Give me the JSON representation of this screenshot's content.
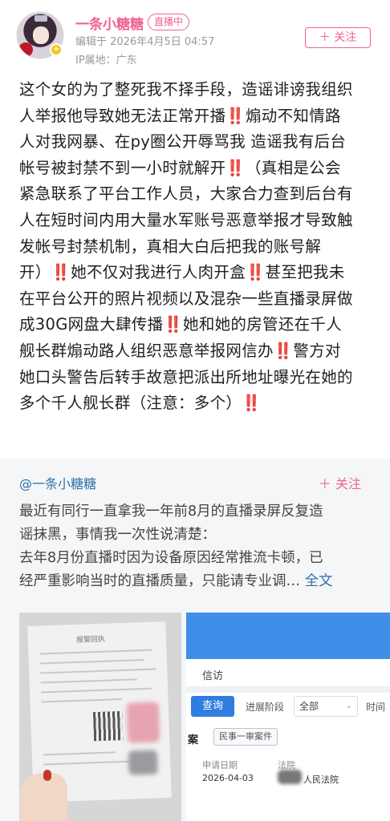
{
  "post": {
    "author": {
      "username": "一条小糖糖",
      "live_badge": "直播中",
      "edited": "编辑于 2026年4月5日 04:57",
      "ip": "IP属地：广东",
      "avatar_icon": "avatar-anime-girl",
      "verified_icon": "vip-badge-icon"
    },
    "follow_label": "＋ 关注",
    "body_lines": [
      {
        "text": "这个女的为了整死我不择手段，造谣诽谤我组织",
        "bang": ""
      },
      {
        "text": "人举报他导致她无法正常开播",
        "bang": "‼️",
        "after": "煽动不知情路"
      },
      {
        "text": "人对我网暴、在py圈公开辱骂我 造谣我有后台",
        "bang": ""
      },
      {
        "text": "帐号被封禁不到一小时就解开",
        "bang": "‼️",
        "after": "（真相是公会"
      },
      {
        "text": "紧急联系了平台工作人员，大家合力查到后台有",
        "bang": ""
      },
      {
        "text": "人在短时间内用大量水军账号恶意举报才导致触",
        "bang": ""
      },
      {
        "text": "发帐号封禁机制，真相大白后把我的账号解",
        "bang": ""
      },
      {
        "text": "开）",
        "bang": "‼️",
        "after": "她不仅对我进行人肉开盒",
        "bang2": "‼️",
        "after2": "甚至把我未"
      },
      {
        "text": "在平台公开的照片视频以及混杂一些直播录屏做",
        "bang": ""
      },
      {
        "text": "成30G网盘大肆传播",
        "bang": "‼️",
        "after": "她和她的房管还在千人"
      },
      {
        "text": "舰长群煽动路人组织恶意举报网信办",
        "bang": "‼️",
        "after": "警方对"
      },
      {
        "text": "她口头警告后转手故意把派出所地址曝光在她的",
        "bang": ""
      },
      {
        "text": "多个千人舰长群（注意：多个）",
        "bang": "‼️"
      }
    ]
  },
  "repost": {
    "author": "@一条小糖糖",
    "follow_label": "＋ 关注",
    "lines": [
      "最近有同行一直拿我一年前8月的直播录屏反复造",
      "谣抹黑，事情我一次性说清楚：",
      "去年8月份直播时因为设备原因经常推流卡顿，已"
    ],
    "last_line": "经严重影响当时的直播质量，只能请专业调…",
    "fulltext_label": "全文",
    "image1": {
      "paper_title": "报警回执"
    },
    "image2": {
      "section_title": "信访",
      "query_button": "查询",
      "stage_label": "进展阶段",
      "stage_value": "全部",
      "time_label": "时间",
      "case_label": "案",
      "case_tag": "民事一审案件",
      "apply_date_label": "申请日期",
      "apply_date_value": "2026-04-03",
      "court_label": "法院",
      "court_value": "人民法院"
    }
  },
  "colors": {
    "accent_pink": "#f06292",
    "link_blue": "#2f6fa8",
    "warning_red": "#e0242b",
    "repost_bg": "#f5f6f8"
  }
}
